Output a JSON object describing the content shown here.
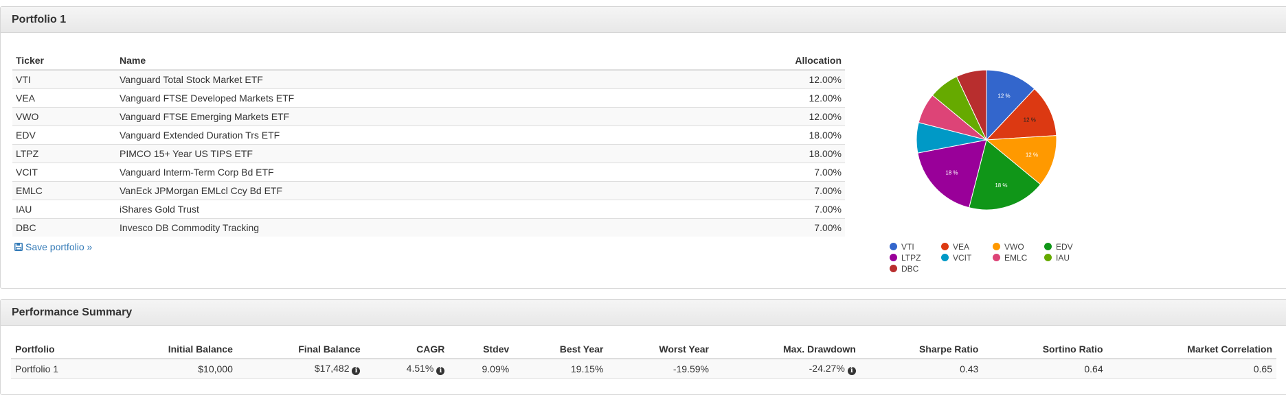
{
  "portfolio_panel": {
    "title": "Portfolio 1",
    "columns": {
      "ticker": "Ticker",
      "name": "Name",
      "allocation": "Allocation"
    },
    "rows": [
      {
        "ticker": "VTI",
        "name": "Vanguard Total Stock Market ETF",
        "allocation": "12.00%"
      },
      {
        "ticker": "VEA",
        "name": "Vanguard FTSE Developed Markets ETF",
        "allocation": "12.00%"
      },
      {
        "ticker": "VWO",
        "name": "Vanguard FTSE Emerging Markets ETF",
        "allocation": "12.00%"
      },
      {
        "ticker": "EDV",
        "name": "Vanguard Extended Duration Trs ETF",
        "allocation": "18.00%"
      },
      {
        "ticker": "LTPZ",
        "name": "PIMCO 15+ Year US TIPS ETF",
        "allocation": "18.00%"
      },
      {
        "ticker": "VCIT",
        "name": "Vanguard Interm-Term Corp Bd ETF",
        "allocation": "7.00%"
      },
      {
        "ticker": "EMLC",
        "name": "VanEck JPMorgan EMLcl Ccy Bd ETF",
        "allocation": "7.00%"
      },
      {
        "ticker": "IAU",
        "name": "iShares Gold Trust",
        "allocation": "7.00%"
      },
      {
        "ticker": "DBC",
        "name": "Invesco DB Commodity Tracking",
        "allocation": "7.00%"
      }
    ],
    "save_link": "Save portfolio »",
    "save_icon": "floppy-disk-icon"
  },
  "chart_data": {
    "type": "pie",
    "categories": [
      "VTI",
      "VEA",
      "VWO",
      "EDV",
      "LTPZ",
      "VCIT",
      "EMLC",
      "IAU",
      "DBC"
    ],
    "values": [
      12,
      12,
      12,
      18,
      18,
      7,
      7,
      7,
      7
    ],
    "slice_labels": [
      "12 %",
      "12 %",
      "12 %",
      "18 %",
      "18 %",
      "",
      "",
      "",
      ""
    ],
    "colors": [
      "#3366cc",
      "#dc3912",
      "#ff9900",
      "#109618",
      "#990099",
      "#0099c6",
      "#dd4477",
      "#66aa00",
      "#b82e2e"
    ],
    "label_colors": [
      "#ffffff",
      "#222222",
      "#ffffff",
      "#ffffff",
      "#ffffff",
      "",
      "",
      "",
      ""
    ],
    "legend_position": "bottom"
  },
  "performance_panel": {
    "title": "Performance Summary",
    "columns": [
      "Portfolio",
      "Initial Balance",
      "Final Balance",
      "CAGR",
      "Stdev",
      "Best Year",
      "Worst Year",
      "Max. Drawdown",
      "Sharpe Ratio",
      "Sortino Ratio",
      "Market Correlation"
    ],
    "row": {
      "portfolio": "Portfolio 1",
      "initial_balance": "$10,000",
      "final_balance": "$17,482",
      "cagr": "4.51%",
      "stdev": "9.09%",
      "best_year": "19.15%",
      "worst_year": "-19.59%",
      "max_drawdown": "-24.27%",
      "sharpe_ratio": "0.43",
      "sortino_ratio": "0.64",
      "market_correlation": "0.65"
    },
    "info_icon": "info-circle-icon",
    "info_glyph": "i"
  }
}
